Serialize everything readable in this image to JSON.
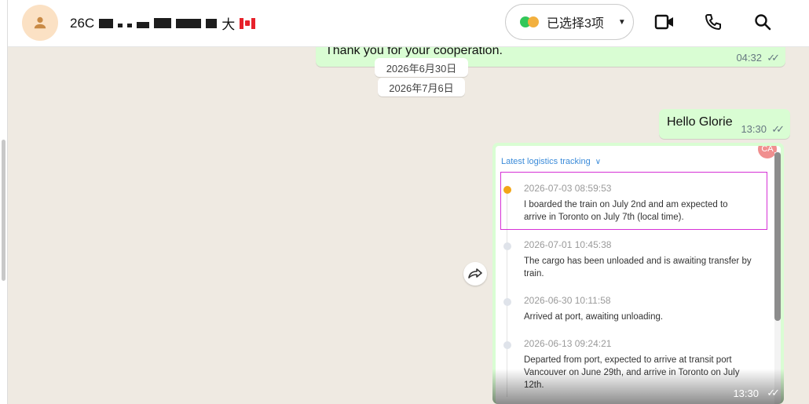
{
  "header": {
    "contact_name_prefix": "26C",
    "contact_name_suffix": "大",
    "selection_label": "已选择3项",
    "icons": {
      "avatar": "person-icon",
      "selection_caret": "caret-down-icon",
      "video": "video-camera-icon",
      "call": "phone-icon",
      "search": "search-icon"
    }
  },
  "messages": {
    "top": {
      "text": "Thank you for your cooperation.",
      "time": "04:32"
    },
    "date_1": "2026年6月30日",
    "date_2": "2026年7月6日",
    "hello": {
      "text": "Hello Glorie",
      "time": "13:30"
    },
    "card": {
      "header": "Latest logistics tracking",
      "badge": "CA",
      "time": "13:30",
      "events": [
        {
          "time": "2026-07-03 08:59:53",
          "desc": "I boarded the train on July 2nd and am expected to arrive in Toronto on July 7th (local time)."
        },
        {
          "time": "2026-07-01 10:45:38",
          "desc": "The cargo has been unloaded and is awaiting transfer by train."
        },
        {
          "time": "2026-06-30 10:11:58",
          "desc": "Arrived at port, awaiting unloading."
        },
        {
          "time": "2026-06-13 09:24:21",
          "desc": "Departed from port, expected to arrive at transit port Vancouver on June 29th, and arrive in Toronto on July 12th."
        }
      ]
    }
  },
  "colors": {
    "outgoing_bubble": "#d9fdd3",
    "chat_bg": "#efeae2",
    "link_blue": "#3b8bd9",
    "active_dot": "#f2a516",
    "highlight": "#d631d6"
  }
}
